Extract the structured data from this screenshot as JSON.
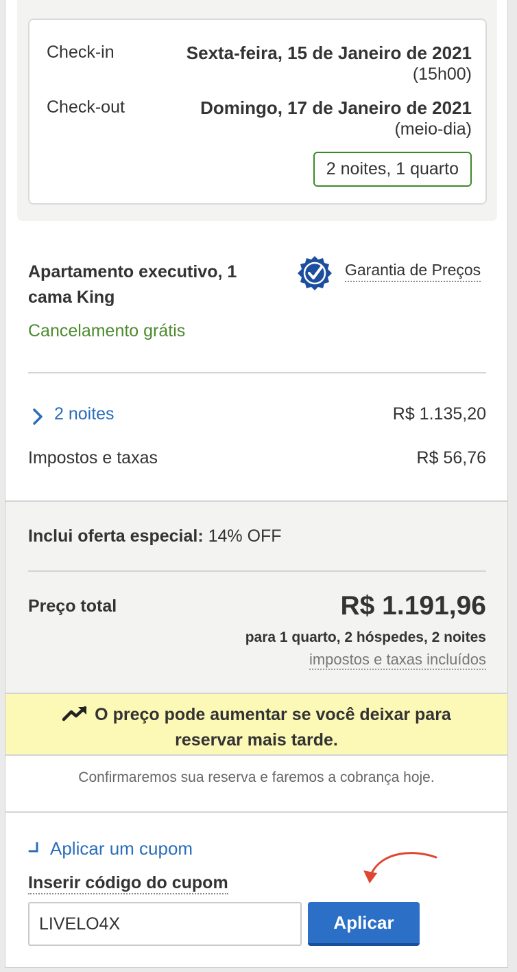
{
  "dates": {
    "checkin_label": "Check-in",
    "checkin_value": "Sexta-feira, 15 de Janeiro de 2021",
    "checkin_time": "(15h00)",
    "checkout_label": "Check-out",
    "checkout_value": "Domingo, 17 de Janeiro de 2021",
    "checkout_time": "(meio-dia)",
    "stay_summary": "2 noites, 1 quarto"
  },
  "room": {
    "name": "Apartamento executivo, 1 cama King",
    "cancellation": "Cancelamento grátis",
    "guarantee_label": "Garantia de Preços",
    "guarantee_icon": "checkmark-seal-icon"
  },
  "breakdown": {
    "nights_label": "2 noites",
    "nights_amount": "R$ 1.135,20",
    "taxes_label": "Impostos e taxas",
    "taxes_amount": "R$ 56,76"
  },
  "offer": {
    "label": "Inclui oferta especial:",
    "value": "14% OFF"
  },
  "total": {
    "label": "Preço total",
    "amount": "R$ 1.191,96",
    "details": "para 1 quarto, 2 hóspedes, 2 noites",
    "taxes_note": "impostos e taxas incluídos"
  },
  "alert": {
    "icon": "trending-up-icon",
    "text": "O preço pode aumentar se você deixar para reservar mais tarde."
  },
  "confirmation_note": "Confirmaremos sua reserva e faremos a cobrança hoje.",
  "coupon": {
    "toggle_label": "Aplicar um cupom",
    "field_label": "Inserir código do cupom",
    "code_value": "LIVELO4X",
    "apply_label": "Aplicar"
  },
  "colors": {
    "link_blue": "#2a6ebb",
    "success_green": "#4d8a2e",
    "button_blue": "#2b6fc7",
    "alert_yellow": "#fcf8b5",
    "annotation_red": "#e0452f"
  }
}
